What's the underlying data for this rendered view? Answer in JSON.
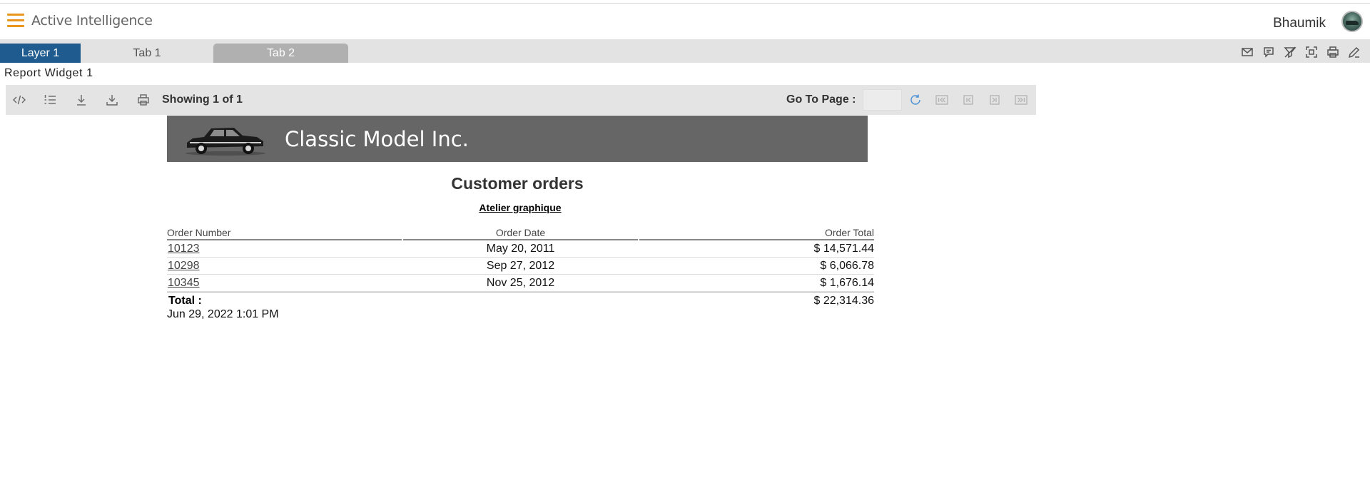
{
  "header": {
    "app_title": "Active Intelligence",
    "user_name": "Bhaumik"
  },
  "tabs": [
    {
      "label": "Layer 1",
      "active": true
    },
    {
      "label": "Tab 1",
      "active": false
    },
    {
      "label": "Tab 2",
      "active": false
    }
  ],
  "widget": {
    "title": "Report Widget 1"
  },
  "report_toolbar": {
    "showing": "Showing 1 of 1",
    "goto_label": "Go To Page :",
    "goto_value": ""
  },
  "report": {
    "banner_title": "Classic Model Inc.",
    "title": "Customer orders",
    "customer": "Atelier graphique",
    "columns": [
      "Order Number",
      "Order Date",
      "Order Total"
    ],
    "rows": [
      {
        "number": "10123",
        "date": "May 20, 2011",
        "total": "$ 14,571.44"
      },
      {
        "number": "10298",
        "date": "Sep 27, 2012",
        "total": "$ 6,066.78"
      },
      {
        "number": "10345",
        "date": "Nov 25, 2012",
        "total": "$ 1,676.14"
      }
    ],
    "total_label": "Total :",
    "total_value": "$ 22,314.36",
    "timestamp": "Jun 29, 2022 1:01 PM"
  },
  "colors": {
    "accent": "#e8961e",
    "active_tab": "#1f5b8e",
    "banner": "#666666",
    "refresh": "#4a8fd4"
  },
  "icons": {
    "header": [
      "hamburger-menu-icon",
      "avatar"
    ],
    "right_toolbar": [
      "mail-icon",
      "comment-icon",
      "clear-filter-icon",
      "capture-icon",
      "print-icon",
      "edit-icon"
    ],
    "report_toolbar": [
      "code-icon",
      "list-icon",
      "download-icon",
      "export-icon",
      "print-icon",
      "refresh-icon",
      "first-page-icon",
      "previous-page-icon",
      "next-page-icon",
      "last-page-icon"
    ]
  }
}
